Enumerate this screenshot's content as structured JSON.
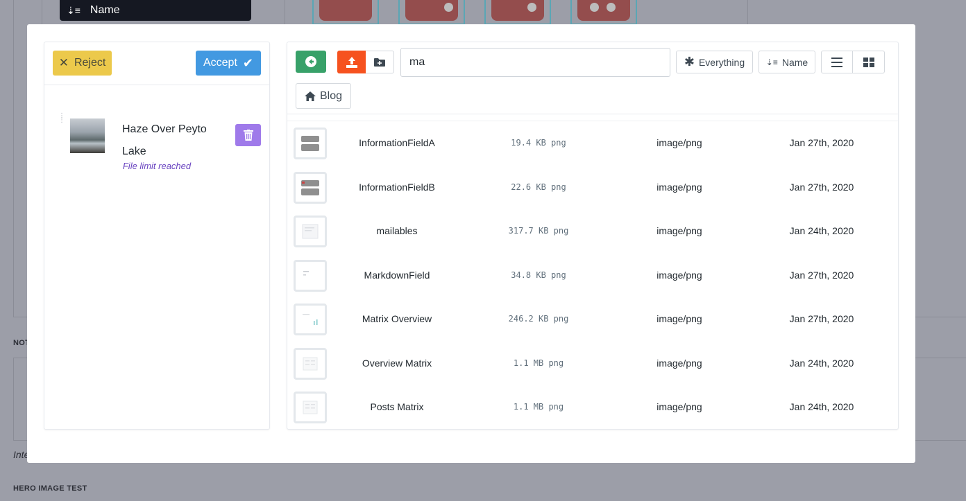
{
  "background": {
    "sort_label": "Name",
    "section_label_notes": "NOT",
    "italic_hint": "Inte",
    "section_label_hero": "HERO IMAGE TEST"
  },
  "selected": {
    "reject_label": "Reject",
    "accept_label": "Accept",
    "item_title": "Haze Over Peyto Lake",
    "file_limit_text": "File limit reached"
  },
  "toolbar": {
    "search_value": "ma",
    "filter_label": "Everything",
    "sort_label": "Name",
    "folder_label": "Blog"
  },
  "files": [
    {
      "name": "InformationFieldA",
      "size": "19.4 KB png",
      "type": "image/png",
      "date": "Jan 27th, 2020"
    },
    {
      "name": "InformationFieldB",
      "size": "22.6 KB png",
      "type": "image/png",
      "date": "Jan 27th, 2020"
    },
    {
      "name": "mailables",
      "size": "317.7 KB png",
      "type": "image/png",
      "date": "Jan 24th, 2020"
    },
    {
      "name": "MarkdownField",
      "size": "34.8 KB png",
      "type": "image/png",
      "date": "Jan 27th, 2020"
    },
    {
      "name": "Matrix Overview",
      "size": "246.2 KB png",
      "type": "image/png",
      "date": "Jan 27th, 2020"
    },
    {
      "name": "Overview Matrix",
      "size": "1.1 MB png",
      "type": "image/png",
      "date": "Jan 24th, 2020"
    },
    {
      "name": "Posts Matrix",
      "size": "1.1 MB png",
      "type": "image/png",
      "date": "Jan 24th, 2020"
    }
  ],
  "colors": {
    "reject": "#ecc94b",
    "accept": "#4299e1",
    "delete": "#9f7aea",
    "back": "#38a169",
    "upload": "#f6521f",
    "file_limit": "#6b46c1"
  }
}
